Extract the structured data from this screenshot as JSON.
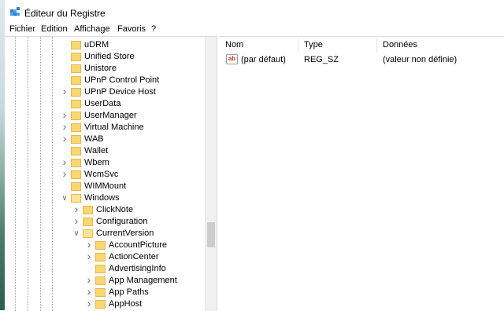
{
  "window": {
    "title": "Éditeur du Registre"
  },
  "menu": [
    "Fichier",
    "Edition",
    "Affichage",
    "Favoris",
    "?"
  ],
  "tree": [
    {
      "label": "uDRM",
      "level": 0,
      "expander": ""
    },
    {
      "label": "Unified Store",
      "level": 0,
      "expander": ""
    },
    {
      "label": "Unistore",
      "level": 0,
      "expander": ""
    },
    {
      "label": "UPnP Control Point",
      "level": 0,
      "expander": ""
    },
    {
      "label": "UPnP Device Host",
      "level": 0,
      "expander": "collapsed"
    },
    {
      "label": "UserData",
      "level": 0,
      "expander": ""
    },
    {
      "label": "UserManager",
      "level": 0,
      "expander": "collapsed"
    },
    {
      "label": "Virtual Machine",
      "level": 0,
      "expander": "collapsed"
    },
    {
      "label": "WAB",
      "level": 0,
      "expander": "collapsed"
    },
    {
      "label": "Wallet",
      "level": 0,
      "expander": ""
    },
    {
      "label": "Wbem",
      "level": 0,
      "expander": "collapsed"
    },
    {
      "label": "WcmSvc",
      "level": 0,
      "expander": "collapsed"
    },
    {
      "label": "WIMMount",
      "level": 0,
      "expander": ""
    },
    {
      "label": "Windows",
      "level": 0,
      "expander": "expanded"
    },
    {
      "label": "ClickNote",
      "level": 1,
      "expander": "collapsed"
    },
    {
      "label": "Configuration",
      "level": 1,
      "expander": "collapsed"
    },
    {
      "label": "CurrentVersion",
      "level": 1,
      "expander": "expanded"
    },
    {
      "label": "AccountPicture",
      "level": 2,
      "expander": "collapsed"
    },
    {
      "label": "ActionCenter",
      "level": 2,
      "expander": "collapsed"
    },
    {
      "label": "AdvertisingInfo",
      "level": 2,
      "expander": ""
    },
    {
      "label": "App Management",
      "level": 2,
      "expander": "collapsed"
    },
    {
      "label": "App Paths",
      "level": 2,
      "expander": "collapsed"
    },
    {
      "label": "AppHost",
      "level": 2,
      "expander": "collapsed"
    }
  ],
  "list": {
    "columns": {
      "name": "Nom",
      "type": "Type",
      "data": "Données"
    },
    "rows": [
      {
        "name": "(par défaut)",
        "type": "REG_SZ",
        "data": "(valeur non définie)",
        "icon": "string-value-icon"
      }
    ]
  }
}
